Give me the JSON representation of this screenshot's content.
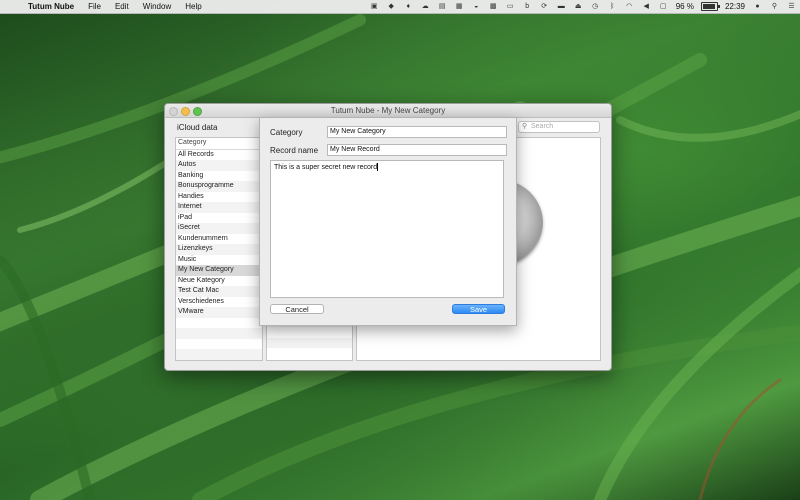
{
  "menubar": {
    "app_name": "Tutum Nube",
    "menus": [
      "File",
      "Edit",
      "Window",
      "Help"
    ],
    "battery_percent": "96 %",
    "time": "22:39"
  },
  "window": {
    "title": "Tutum Nube - My New Category",
    "pane_title": "iCloud data",
    "search_placeholder": "Search",
    "category_header": "Category",
    "categories": [
      "All Records",
      "Autos",
      "Banking",
      "Bonusprogramme",
      "Handies",
      "Internet",
      "iPad",
      "iSecret",
      "Kundenummern",
      "Lizenzkeys",
      "Music",
      "My New Category",
      "Neue Kategory",
      "Test Cat Mac",
      "Verschiedenes",
      "VMware"
    ],
    "selected_category": "My New Category"
  },
  "sheet": {
    "category_label": "Category",
    "category_value": "My New Category",
    "record_label": "Record name",
    "record_value": "My New Record",
    "body_text": "This is a super secret new record",
    "cancel_label": "Cancel",
    "save_label": "Save"
  },
  "colors": {
    "accent": "#2c8bf5"
  }
}
